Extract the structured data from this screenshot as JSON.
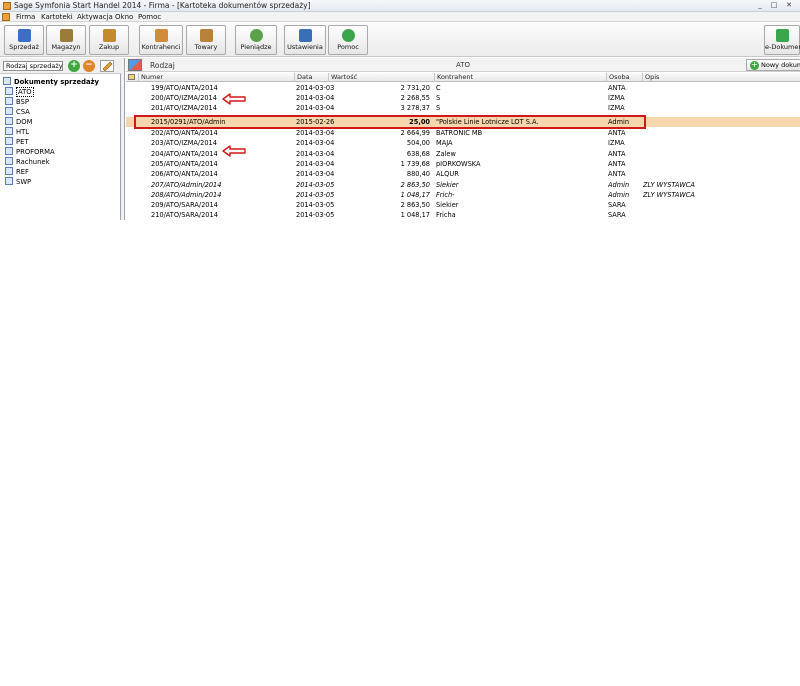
{
  "window": {
    "title": "Sage Symfonia Start Handel 2014 - Firma - [Kartoteka dokumentów sprzedaży]",
    "controls": [
      "_",
      "□",
      "✕"
    ]
  },
  "menu": [
    "Firma",
    "Kartoteki",
    "Aktywacja",
    "Okno",
    "Pomoc"
  ],
  "toolbar": {
    "buttons": [
      {
        "label": "Sprzedaż",
        "icon": "sales-icon",
        "color": "#3b6fc4"
      },
      {
        "label": "Magazyn",
        "icon": "warehouse-icon",
        "color": "#9a7b3a"
      },
      {
        "label": "Zakup",
        "icon": "purchase-icon",
        "color": "#c48a2e"
      },
      {
        "label": "Kontrahenci",
        "icon": "contractors-icon",
        "color": "#d08a3a"
      },
      {
        "label": "Towary",
        "icon": "goods-icon",
        "color": "#b9823b"
      },
      {
        "label": "Pieniądze",
        "icon": "money-icon",
        "color": "#5aa34a"
      },
      {
        "label": "Ustawienia",
        "icon": "settings-icon",
        "color": "#3a6fb8"
      },
      {
        "label": "Pomoc",
        "icon": "help-icon",
        "color": "#3aa54a"
      },
      {
        "label": "e-Dokumen",
        "icon": "e-document-icon",
        "color": "#3aa54a"
      }
    ]
  },
  "left_panel": {
    "select_value": "Rodzaj sprzedaży",
    "tree_root": "Dokumenty sprzedaży",
    "items": [
      "ATO",
      "BSP",
      "CSA",
      "DOM",
      "HTL",
      "PET",
      "PROFORMA",
      "Rachunek",
      "REF",
      "SWP"
    ]
  },
  "right_panel": {
    "header_label": "Rodzaj",
    "header_filter": "ATO",
    "new_button": "Nowy dokum",
    "columns": [
      "Numer",
      "Data",
      "Wartość",
      "Kontrahent",
      "Osoba",
      "Opis"
    ],
    "rows": [
      {
        "numer": "199/ATO/ANTA/2014",
        "data": "2014-03-03",
        "wartosc": "2 731,20",
        "kontrahent": "C",
        "osoba": "ANTA",
        "opis": ""
      },
      {
        "numer": "200/ATO/IZMA/2014",
        "data": "2014-03-04",
        "wartosc": "2 268,55",
        "kontrahent": "S",
        "osoba": "IZMA",
        "opis": ""
      },
      {
        "numer": "201/ATO/IZMA/2014",
        "data": "2014-03-04",
        "wartosc": "3 278,37",
        "kontrahent": "S",
        "osoba": "IZMA",
        "opis": ""
      },
      {
        "numer": "2015/0291/ATO/Admin",
        "data": "2015-02-26",
        "wartosc": "25,00",
        "kontrahent": "\"Polskie Linie Lotnicze LOT S.A.",
        "osoba": "Admin",
        "opis": ""
      },
      {
        "numer": "202/ATO/ANTA/2014",
        "data": "2014-03-04",
        "wartosc": "2 664,99",
        "kontrahent": "BATRONIC MB",
        "osoba": "ANTA",
        "opis": ""
      },
      {
        "numer": "203/ATO/IZMA/2014",
        "data": "2014-03-04",
        "wartosc": "504,00",
        "kontrahent": "MAJA",
        "osoba": "IZMA",
        "opis": ""
      },
      {
        "numer": "204/ATO/ANTA/2014",
        "data": "2014-03-04",
        "wartosc": "638,68",
        "kontrahent": "Zalew",
        "osoba": "ANTA",
        "opis": ""
      },
      {
        "numer": "205/ATO/ANTA/2014",
        "data": "2014-03-04",
        "wartosc": "1 739,68",
        "kontrahent": "pIORKOWSKA",
        "osoba": "ANTA",
        "opis": ""
      },
      {
        "numer": "206/ATO/ANTA/2014",
        "data": "2014-03-04",
        "wartosc": "880,40",
        "kontrahent": "ALQUR",
        "osoba": "ANTA",
        "opis": ""
      },
      {
        "numer": "207/ATO/Admin/2014",
        "data": "2014-03-05",
        "wartosc": "2 863,50",
        "kontrahent": "Siekier",
        "osoba": "Admin",
        "opis": "ZLY WYSTAWCA"
      },
      {
        "numer": "208/ATO/Admin/2014",
        "data": "2014-03-05",
        "wartosc": "1 048,17",
        "kontrahent": "Frich-",
        "osoba": "Admin",
        "opis": "ZLY WYSTAWCA"
      },
      {
        "numer": "209/ATO/SARA/2014",
        "data": "2014-03-05",
        "wartosc": "2 863,50",
        "kontrahent": "Siekier",
        "osoba": "SARA",
        "opis": ""
      },
      {
        "numer": "210/ATO/SARA/2014",
        "data": "2014-03-05",
        "wartosc": "1 048,17",
        "kontrahent": "Fricha",
        "osoba": "SARA",
        "opis": ""
      }
    ]
  },
  "annotation": {
    "color": "#d01818"
  }
}
